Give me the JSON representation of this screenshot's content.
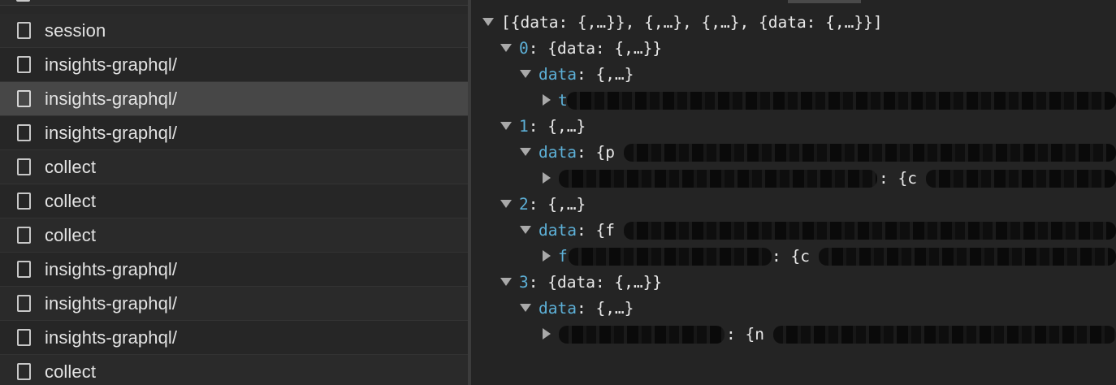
{
  "requests": [
    {
      "name": "session"
    },
    {
      "name": "insights-graphql/"
    },
    {
      "name": "insights-graphql/"
    },
    {
      "name": "insights-graphql/"
    },
    {
      "name": "collect"
    },
    {
      "name": "collect"
    },
    {
      "name": "collect"
    },
    {
      "name": "insights-graphql/"
    },
    {
      "name": "insights-graphql/"
    },
    {
      "name": "insights-graphql/"
    },
    {
      "name": "collect"
    }
  ],
  "selected_index": 2,
  "tree": {
    "root": "[{data: {,…}}, {,…}, {,…}, {data: {,…}}]",
    "item0_key": "0",
    "item0_summary": "{data: {,…}}",
    "item0_data_key": "data",
    "item0_data_summary": "{,…}",
    "item0_child_prefix": "t",
    "item1_key": "1",
    "item1_summary": "{,…}",
    "item1_data_key": "data",
    "item1_data_summary": "{p",
    "item1_child_colon": ": {c",
    "item2_key": "2",
    "item2_summary": "{,…}",
    "item2_data_key": "data",
    "item2_data_summary": "{f",
    "item2_child_prefix": "f",
    "item2_child_colon": ": {c",
    "item3_key": "3",
    "item3_summary": "{data: {,…}}",
    "item3_data_key": "data",
    "item3_data_summary": "{,…}",
    "item3_child_colon": ": {n"
  }
}
